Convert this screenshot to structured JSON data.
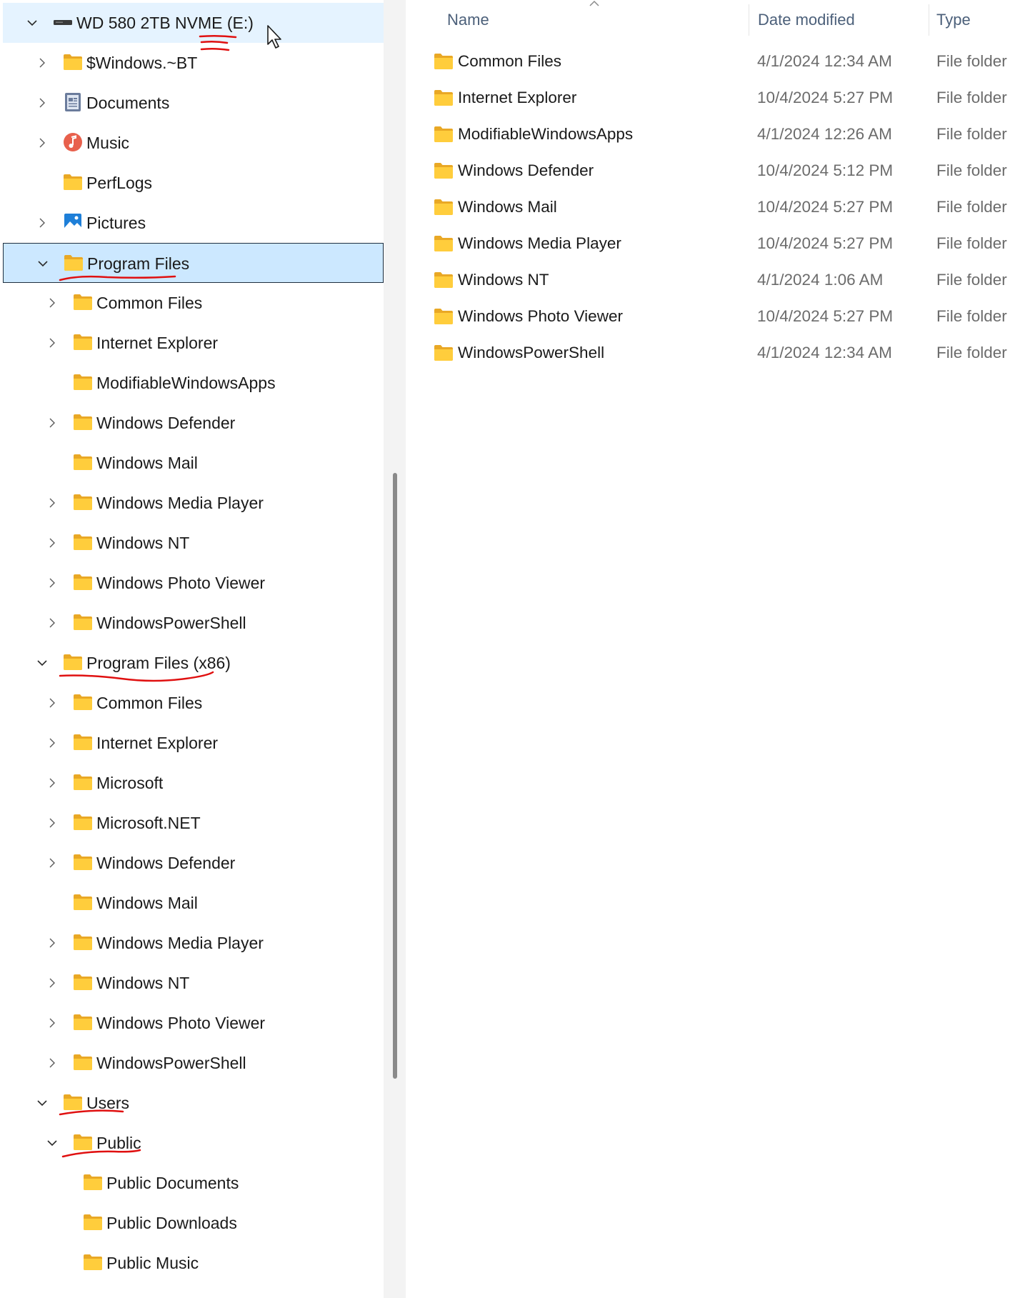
{
  "nav": {
    "items": [
      {
        "label": "WD 580 2TB NVME (E:)",
        "icon": "drive-icon",
        "level": 0,
        "chevron": "expanded",
        "state": "hover"
      },
      {
        "label": "$Windows.~BT",
        "icon": "folder-icon",
        "level": 1,
        "chevron": "collapsed"
      },
      {
        "label": "Documents",
        "icon": "documents-icon",
        "level": 1,
        "chevron": "collapsed"
      },
      {
        "label": "Music",
        "icon": "music-icon",
        "level": 1,
        "chevron": "collapsed"
      },
      {
        "label": "PerfLogs",
        "icon": "folder-icon",
        "level": 1,
        "chevron": "none"
      },
      {
        "label": "Pictures",
        "icon": "pictures-icon",
        "level": 1,
        "chevron": "collapsed"
      },
      {
        "label": "Program Files",
        "icon": "folder-icon",
        "level": 1,
        "chevron": "expanded",
        "state": "selected"
      },
      {
        "label": "Common Files",
        "icon": "folder-icon",
        "level": 2,
        "chevron": "collapsed"
      },
      {
        "label": "Internet Explorer",
        "icon": "folder-icon",
        "level": 2,
        "chevron": "collapsed"
      },
      {
        "label": "ModifiableWindowsApps",
        "icon": "folder-icon",
        "level": 2,
        "chevron": "none"
      },
      {
        "label": "Windows Defender",
        "icon": "folder-icon",
        "level": 2,
        "chevron": "collapsed"
      },
      {
        "label": "Windows Mail",
        "icon": "folder-icon",
        "level": 2,
        "chevron": "none"
      },
      {
        "label": "Windows Media Player",
        "icon": "folder-icon",
        "level": 2,
        "chevron": "collapsed"
      },
      {
        "label": "Windows NT",
        "icon": "folder-icon",
        "level": 2,
        "chevron": "collapsed"
      },
      {
        "label": "Windows Photo Viewer",
        "icon": "folder-icon",
        "level": 2,
        "chevron": "collapsed"
      },
      {
        "label": "WindowsPowerShell",
        "icon": "folder-icon",
        "level": 2,
        "chevron": "collapsed"
      },
      {
        "label": "Program Files (x86)",
        "icon": "folder-icon",
        "level": 1,
        "chevron": "expanded"
      },
      {
        "label": "Common Files",
        "icon": "folder-icon",
        "level": 2,
        "chevron": "collapsed"
      },
      {
        "label": "Internet Explorer",
        "icon": "folder-icon",
        "level": 2,
        "chevron": "collapsed"
      },
      {
        "label": "Microsoft",
        "icon": "folder-icon",
        "level": 2,
        "chevron": "collapsed"
      },
      {
        "label": "Microsoft.NET",
        "icon": "folder-icon",
        "level": 2,
        "chevron": "collapsed"
      },
      {
        "label": "Windows Defender",
        "icon": "folder-icon",
        "level": 2,
        "chevron": "collapsed"
      },
      {
        "label": "Windows Mail",
        "icon": "folder-icon",
        "level": 2,
        "chevron": "none"
      },
      {
        "label": "Windows Media Player",
        "icon": "folder-icon",
        "level": 2,
        "chevron": "collapsed"
      },
      {
        "label": "Windows NT",
        "icon": "folder-icon",
        "level": 2,
        "chevron": "collapsed"
      },
      {
        "label": "Windows Photo Viewer",
        "icon": "folder-icon",
        "level": 2,
        "chevron": "collapsed"
      },
      {
        "label": "WindowsPowerShell",
        "icon": "folder-icon",
        "level": 2,
        "chevron": "collapsed"
      },
      {
        "label": "Users",
        "icon": "folder-icon",
        "level": 1,
        "chevron": "expanded"
      },
      {
        "label": "Public",
        "icon": "folder-icon",
        "level": 2,
        "chevron": "expanded"
      },
      {
        "label": "Public Documents",
        "icon": "folder-icon",
        "level": 3,
        "chevron": "none"
      },
      {
        "label": "Public Downloads",
        "icon": "folder-icon",
        "level": 3,
        "chevron": "none"
      },
      {
        "label": "Public Music",
        "icon": "folder-icon",
        "level": 3,
        "chevron": "none"
      }
    ]
  },
  "list": {
    "columns": {
      "name": "Name",
      "date": "Date modified",
      "type": "Type"
    },
    "sort_column": "name",
    "rows": [
      {
        "name": "Common Files",
        "date": "4/1/2024 12:34 AM",
        "type": "File folder"
      },
      {
        "name": "Internet Explorer",
        "date": "10/4/2024 5:27 PM",
        "type": "File folder"
      },
      {
        "name": "ModifiableWindowsApps",
        "date": "4/1/2024 12:26 AM",
        "type": "File folder"
      },
      {
        "name": "Windows Defender",
        "date": "10/4/2024 5:12 PM",
        "type": "File folder"
      },
      {
        "name": "Windows Mail",
        "date": "10/4/2024 5:27 PM",
        "type": "File folder"
      },
      {
        "name": "Windows Media Player",
        "date": "10/4/2024 5:27 PM",
        "type": "File folder"
      },
      {
        "name": "Windows NT",
        "date": "4/1/2024 1:06 AM",
        "type": "File folder"
      },
      {
        "name": "Windows Photo Viewer",
        "date": "10/4/2024 5:27 PM",
        "type": "File folder"
      },
      {
        "name": "WindowsPowerShell",
        "date": "4/1/2024 12:34 AM",
        "type": "File folder"
      }
    ]
  },
  "colors": {
    "hover": "#e5f3ff",
    "selected": "#cce8ff",
    "folder": "#ffca28",
    "annotation": "#e01010"
  }
}
